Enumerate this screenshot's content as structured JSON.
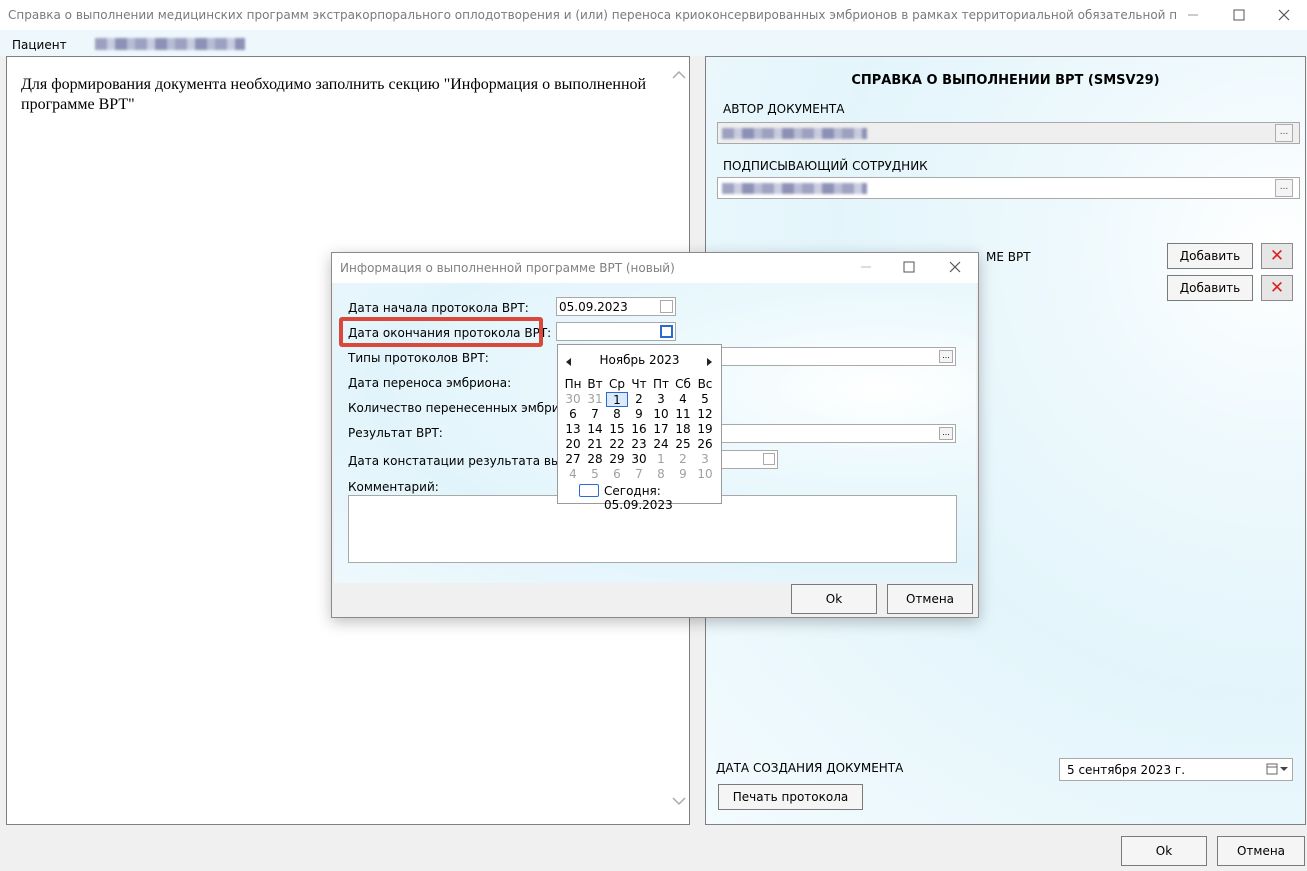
{
  "window": {
    "title": "Справка о выполнении медицинских программ экстракорпорального оплодотворения и (или) переноса криоконсервированных эмбрионов в рамках территориальной обязательной программы медицинск…",
    "minimize_icon": "minimize-icon",
    "maximize_icon": "maximize-icon",
    "close_icon": "close-icon"
  },
  "menu": {
    "patient_label": "Пациент"
  },
  "left_panel": {
    "message": "Для формирования документа необходимо заполнить секцию \"Информация о выполненной программе ВРТ\""
  },
  "right_panel": {
    "title": "СПРАВКА О ВЫПОЛНЕНИИ ВРТ (SMSV29)",
    "author_label": "АВТОР ДОКУМЕНТА",
    "signer_label": "ПОДПИСЫВАЮЩИЙ СОТРУДНИК",
    "section_label": "МЕ ВРТ",
    "add_button": "Добавить",
    "add_button_2": "Добавить",
    "creation_date_label": "ДАТА СОЗДАНИЯ ДОКУМЕНТА",
    "creation_date_value": "5 сентября 2023 г.",
    "print_button": "Печать протокола",
    "dots": "..."
  },
  "footer": {
    "ok": "Ok",
    "cancel": "Отмена"
  },
  "dialog": {
    "title": "Информация о выполненной программе ВРТ (новый)",
    "labels": {
      "start_date": "Дата начала протокола ВРТ:",
      "end_date": "Дата окончания протокола ВРТ:",
      "protocol_types": "Типы протоколов ВРТ:",
      "transfer_date": "Дата переноса эмбриона:",
      "embryo_count": "Количество перенесенных эмбрионо",
      "result": "Результат ВРТ:",
      "result_date": "Дата констатации результата выполне",
      "comment": "Комментарий:"
    },
    "start_date_value": "05.09.2023",
    "end_date_value": "",
    "ok": "Ok",
    "cancel": "Отмена"
  },
  "calendar": {
    "month_label": "Ноябрь 2023",
    "weekdays": [
      "Пн",
      "Вт",
      "Ср",
      "Чт",
      "Пт",
      "Сб",
      "Вс"
    ],
    "days": [
      [
        "30",
        "31",
        "1",
        "2",
        "3",
        "4",
        "5"
      ],
      [
        "6",
        "7",
        "8",
        "9",
        "10",
        "11",
        "12"
      ],
      [
        "13",
        "14",
        "15",
        "16",
        "17",
        "18",
        "19"
      ],
      [
        "20",
        "21",
        "22",
        "23",
        "24",
        "25",
        "26"
      ],
      [
        "27",
        "28",
        "29",
        "30",
        "1",
        "2",
        "3"
      ],
      [
        "4",
        "5",
        "6",
        "7",
        "8",
        "9",
        "10"
      ]
    ],
    "selected_day": "1",
    "today_label": "Сегодня: 05.09.2023"
  },
  "colors": {
    "highlight_border": "#d9483b",
    "selection": "#2a6bd1",
    "delete_icon": "#dd2222"
  }
}
